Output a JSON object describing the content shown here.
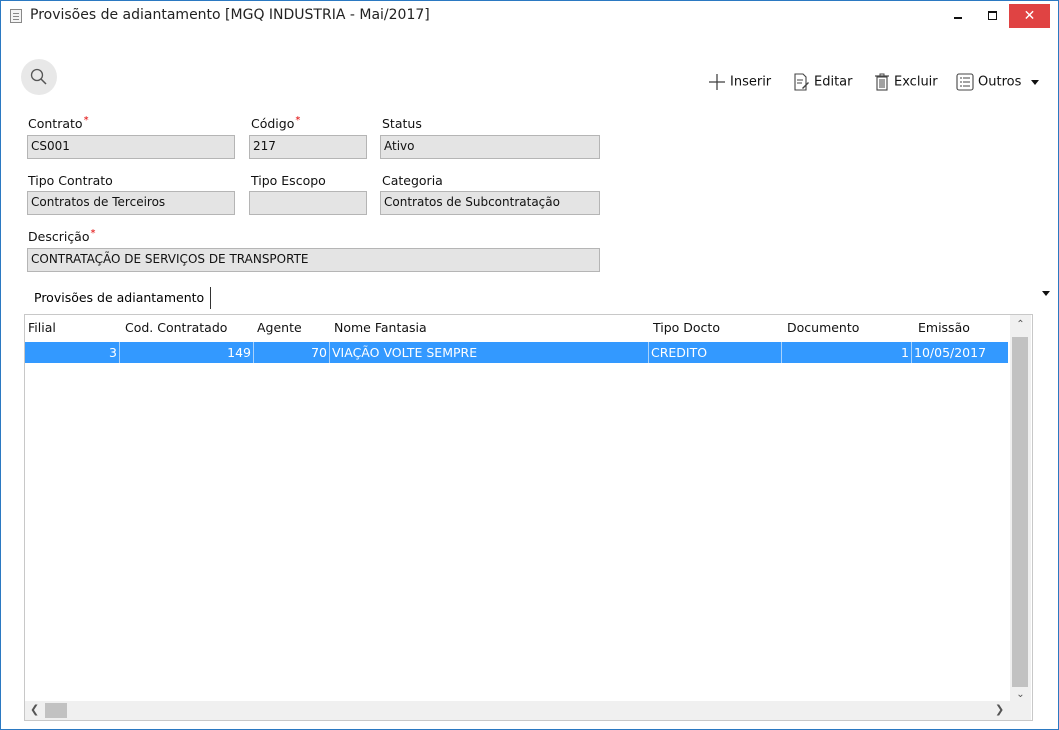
{
  "window": {
    "title": "Provisões de adiantamento [MGQ INDUSTRIA - Mai/2017]",
    "minimize_glyph": "_",
    "maximize_glyph": "□",
    "close_glyph": "✕"
  },
  "toolbar": {
    "insert_label": "Inserir",
    "edit_label": "Editar",
    "delete_label": "Excluir",
    "more_label": "Outros"
  },
  "form": {
    "contrato": {
      "label": "Contrato",
      "value": "CS001"
    },
    "codigo": {
      "label": "Código",
      "value": "217"
    },
    "status": {
      "label": "Status",
      "value": "Ativo"
    },
    "tipo_contrato": {
      "label": "Tipo Contrato",
      "value": "Contratos de Terceiros"
    },
    "tipo_escopo": {
      "label": "Tipo Escopo",
      "value": ""
    },
    "categoria": {
      "label": "Categoria",
      "value": "Contratos de Subcontratação"
    },
    "descricao": {
      "label": "Descrição",
      "value": "CONTRATAÇÃO DE SERVIÇOS DE TRANSPORTE"
    },
    "required_mark": "*"
  },
  "tabs": [
    {
      "label": "Provisões de adiantamento"
    }
  ],
  "grid": {
    "columns": [
      "Filial",
      "Cod. Contratado",
      "Agente",
      "Nome Fantasia",
      "Tipo Docto",
      "Documento",
      "Emissão"
    ],
    "rows": [
      {
        "filial": "3",
        "cod_contratado": "149",
        "agente": "70",
        "nome_fantasia": "VIAÇÃO VOLTE SEMPRE",
        "tipo_docto": "CREDITO",
        "documento": "1",
        "emissao": "10/05/2017"
      }
    ]
  },
  "colors": {
    "selection": "#3399ff",
    "close": "#e04343",
    "required": "#e00000"
  },
  "icons": [
    "search-icon",
    "plus-icon",
    "edit-icon",
    "trash-icon",
    "list-icon",
    "dropdown-arrow-icon"
  ]
}
